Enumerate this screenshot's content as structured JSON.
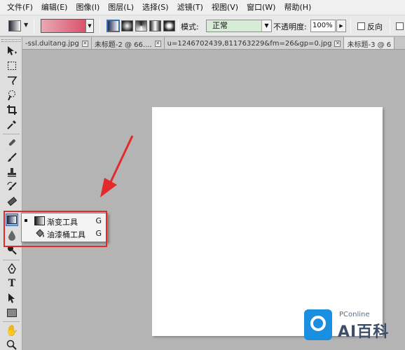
{
  "menubar": {
    "items": [
      "文件(F)",
      "编辑(E)",
      "图像(I)",
      "图层(L)",
      "选择(S)",
      "滤镜(T)",
      "视图(V)",
      "窗口(W)",
      "帮助(H)"
    ]
  },
  "options_bar": {
    "mode_label": "模式:",
    "mode_value": "正常",
    "opacity_label": "不透明度:",
    "opacity_value": "100%",
    "reverse_label": "反向",
    "gradient_colors": [
      "#e9a9b5",
      "#d8435e"
    ]
  },
  "tabs": [
    {
      "label": "-ssl.duitang.jpg",
      "active": false
    },
    {
      "label": "未标题-2 @ 66....",
      "active": false
    },
    {
      "label": "u=1246702439,811763229&fm=26&gp=0.jpg",
      "active": false
    },
    {
      "label": "未标题-3 @ 6",
      "active": true
    }
  ],
  "flyout": {
    "items": [
      {
        "label": "渐变工具",
        "shortcut": "G",
        "selected": true,
        "icon": "gradient-tool-icon"
      },
      {
        "label": "油漆桶工具",
        "shortcut": "G",
        "selected": false,
        "icon": "paint-bucket-icon"
      }
    ]
  },
  "annotation": {
    "color": "#e22a2a"
  },
  "watermark": {
    "small": "PConline",
    "big": "AI百科"
  }
}
